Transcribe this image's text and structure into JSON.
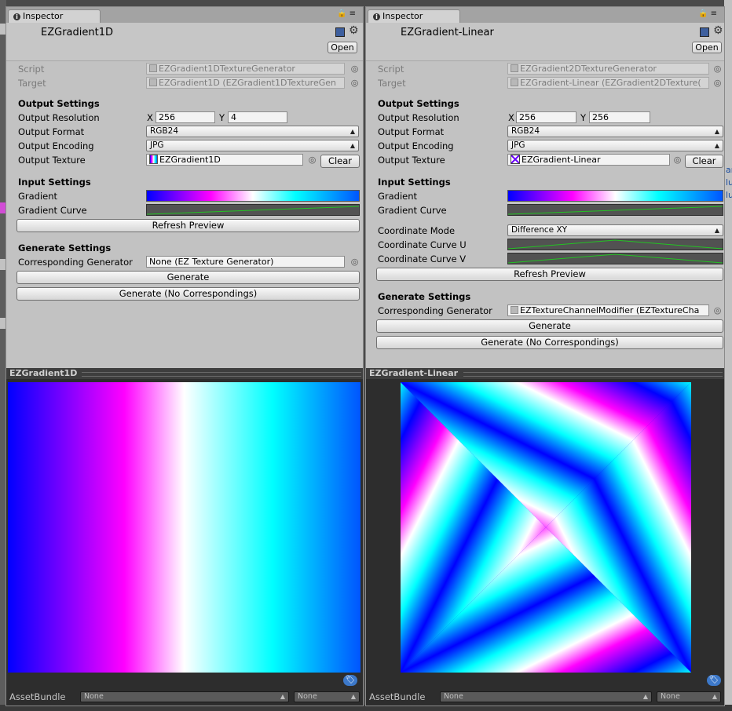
{
  "left": {
    "tab_label": "Inspector",
    "object_name": "EZGradient1D",
    "open_label": "Open",
    "script_label": "Script",
    "script_value": "EZGradient1DTextureGenerator",
    "target_label": "Target",
    "target_value": "EZGradient1D (EZGradient1DTextureGen",
    "output_settings": "Output Settings",
    "output_resolution": "Output Resolution",
    "res_x_label": "X",
    "res_x": "256",
    "res_y_label": "Y",
    "res_y": "4",
    "output_format": "Output Format",
    "format_value": "RGB24",
    "output_encoding": "Output Encoding",
    "encoding_value": "JPG",
    "output_texture": "Output Texture",
    "texture_value": "EZGradient1D",
    "clear_label": "Clear",
    "input_settings": "Input Settings",
    "gradient_label": "Gradient",
    "gradient_curve_label": "Gradient Curve",
    "refresh_label": "Refresh Preview",
    "generate_settings": "Generate Settings",
    "corresponding_label": "Corresponding Generator",
    "corresponding_value": "None (EZ Texture Generator)",
    "generate_label": "Generate",
    "generate_nc_label": "Generate (No Correspondings)",
    "preview_title": "EZGradient1D",
    "assetbundle_label": "AssetBundle",
    "assetbundle_value": "None",
    "assetbundle_variant": "None"
  },
  "right": {
    "tab_label": "Inspector",
    "object_name": "EZGradient-Linear",
    "open_label": "Open",
    "script_label": "Script",
    "script_value": "EZGradient2DTextureGenerator",
    "target_label": "Target",
    "target_value": "EZGradient-Linear (EZGradient2DTexture(",
    "output_settings": "Output Settings",
    "output_resolution": "Output Resolution",
    "res_x_label": "X",
    "res_x": "256",
    "res_y_label": "Y",
    "res_y": "256",
    "output_format": "Output Format",
    "format_value": "RGB24",
    "output_encoding": "Output Encoding",
    "encoding_value": "JPG",
    "output_texture": "Output Texture",
    "texture_value": "EZGradient-Linear",
    "clear_label": "Clear",
    "input_settings": "Input Settings",
    "gradient_label": "Gradient",
    "gradient_curve_label": "Gradient Curve",
    "coord_mode_label": "Coordinate Mode",
    "coord_mode_value": "Difference XY",
    "curve_u_label": "Coordinate Curve U",
    "curve_v_label": "Coordinate Curve V",
    "refresh_label": "Refresh Preview",
    "generate_settings": "Generate Settings",
    "corresponding_label": "Corresponding Generator",
    "corresponding_value": "EZTextureChannelModifier (EZTextureCha",
    "generate_label": "Generate",
    "generate_nc_label": "Generate (No Correspondings)",
    "preview_title": "EZGradient-Linear",
    "assetbundle_label": "AssetBundle",
    "assetbundle_value": "None",
    "assetbundle_variant": "None"
  },
  "background": {
    "right_edge_fragments": [
      "ar",
      "lu",
      "lu"
    ]
  },
  "colors": {
    "panel_bg": "#c2c2c2",
    "preview_bg": "#2d2d2d",
    "gradient_stops": [
      "#0000ff",
      "#ff00ff",
      "#ffffff",
      "#00ffff",
      "#0055ff"
    ]
  },
  "icons": [
    "info-icon",
    "lock-icon",
    "menu-icon",
    "book-icon",
    "gear-icon",
    "object-picker-icon",
    "tag-icon",
    "dropdown-arrow-icon"
  ]
}
